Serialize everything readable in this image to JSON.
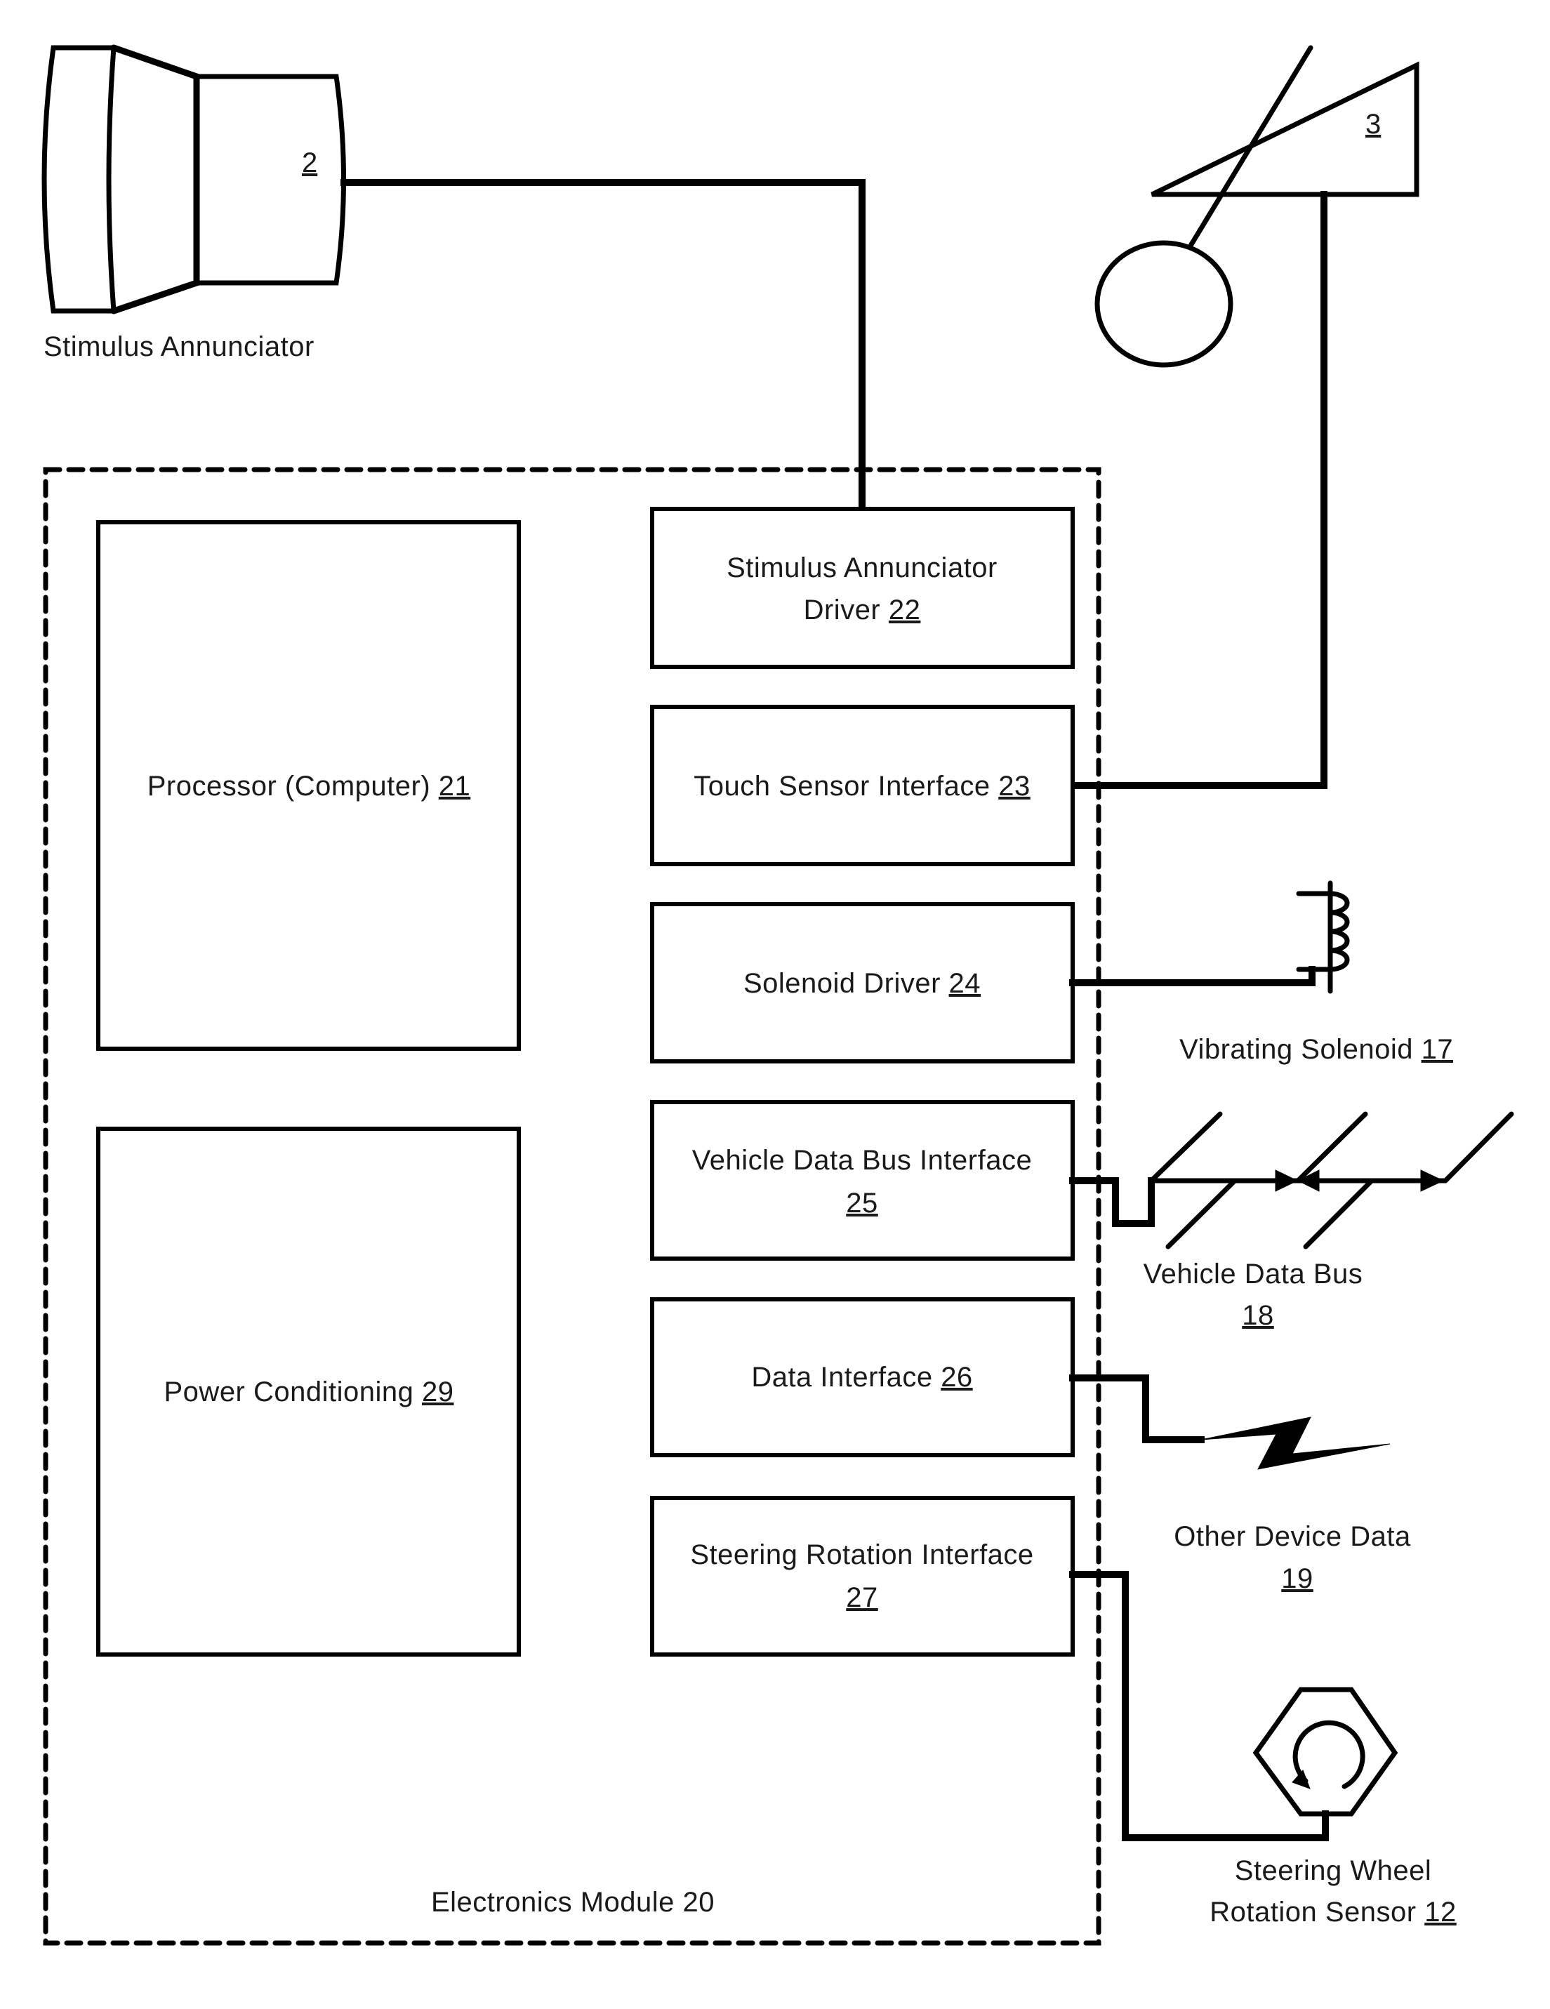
{
  "figure": {
    "module": {
      "label": "Electronics Module 20"
    },
    "blocks": [
      {
        "id": "processor",
        "label": "Processor (Computer)",
        "ref": "21"
      },
      {
        "id": "power",
        "label": "Power Conditioning",
        "ref": "29"
      },
      {
        "id": "stimulus-driver",
        "label_line1": "Stimulus Annunciator",
        "label_line2": "Driver",
        "ref": "22"
      },
      {
        "id": "touch-sensor",
        "label": "Touch Sensor Interface",
        "ref": "23"
      },
      {
        "id": "solenoid-driver",
        "label": "Solenoid Driver",
        "ref": "24"
      },
      {
        "id": "vehicle-bus-interface",
        "label": "Vehicle Data Bus Interface",
        "ref": "25"
      },
      {
        "id": "data-interface",
        "label": "Data Interface",
        "ref": "26"
      },
      {
        "id": "steering-interface",
        "label": "Steering Rotation Interface",
        "ref": "27"
      }
    ],
    "external": {
      "stimulus_annunciator": {
        "label": "Stimulus Annunciator",
        "ref": "2",
        "icon": "speaker-icon"
      },
      "touch_sensor": {
        "ref": "3",
        "icon": "touch-sensor-icon"
      },
      "vibrating_solenoid": {
        "label": "Vibrating Solenoid",
        "ref": "17",
        "icon": "solenoid-coil-icon"
      },
      "vehicle_data_bus": {
        "label": "Vehicle Data Bus",
        "ref": "18",
        "icon": "data-bus-icon"
      },
      "other_device_data": {
        "label": "Other Device Data",
        "ref": "19",
        "icon": "wireless-link-icon"
      },
      "steering_sensor": {
        "label_line1": "Steering Wheel",
        "label_line2": "Rotation Sensor",
        "ref": "12",
        "icon": "rotation-sensor-icon"
      }
    }
  }
}
